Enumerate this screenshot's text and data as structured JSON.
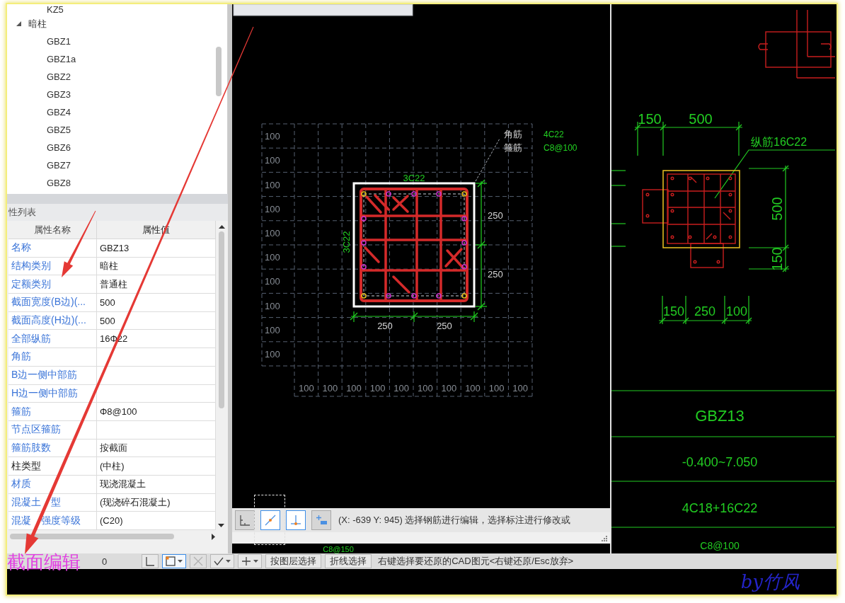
{
  "tree": {
    "items": [
      {
        "children": [
          {
            "label": "KZ5"
          }
        ]
      },
      {
        "label": "暗柱",
        "expanded": true,
        "children": [
          {
            "label": "GBZ1"
          },
          {
            "label": "GBZ1a"
          },
          {
            "label": "GBZ2"
          },
          {
            "label": "GBZ3"
          },
          {
            "label": "GBZ4"
          },
          {
            "label": "GBZ5"
          },
          {
            "label": "GBZ6"
          },
          {
            "label": "GBZ7"
          },
          {
            "label": "GBZ8"
          }
        ]
      }
    ]
  },
  "properties": {
    "title": "性列表",
    "columns": [
      "属性名称",
      "属性值"
    ],
    "rows": [
      {
        "name": "名称",
        "value": "GBZ13",
        "color": "#3a74d8"
      },
      {
        "name": "结构类别",
        "value": "暗柱",
        "color": "#3a74d8"
      },
      {
        "name": "定额类别",
        "value": "普通柱",
        "color": "#3a74d8"
      },
      {
        "name": "截面宽度(B边)(...",
        "value": "500",
        "color": "#3a74d8"
      },
      {
        "name": "截面高度(H边)(...",
        "value": "500",
        "color": "#3a74d8"
      },
      {
        "name": "全部纵筋",
        "value": "16Φ22",
        "color": "#3a74d8"
      },
      {
        "name": "角筋",
        "color": "#3a74d8"
      },
      {
        "name": "B边一侧中部筋",
        "color": "#3a74d8"
      },
      {
        "name": "H边一侧中部筋",
        "color": "#3a74d8"
      },
      {
        "name": "箍筋",
        "value": "Φ8@100",
        "color": "#3a74d8"
      },
      {
        "name": "节点区箍筋",
        "color": "#3a74d8"
      },
      {
        "name": "箍筋肢数",
        "value": "按截面",
        "color": "#3a74d8"
      },
      {
        "name": "柱类型",
        "value": "(中柱)",
        "color": "#222222"
      },
      {
        "name": "材质",
        "value": "现浇混凝土",
        "color": "#3a74d8"
      },
      {
        "name": "混凝土　型",
        "value": "(现浇碎石混凝土)",
        "color": "#3a74d8"
      },
      {
        "name": "混凝　强度等级",
        "value": "(C20)",
        "color": "#3a74d8"
      }
    ]
  },
  "section_editor": {
    "grid": {
      "row_labels": [
        "100",
        "100",
        "100",
        "100",
        "100",
        "100",
        "100",
        "100",
        "100",
        "100"
      ],
      "column_labels": [
        "100",
        "100",
        "100",
        "100",
        "100",
        "100",
        "100",
        "100",
        "100",
        "100"
      ]
    },
    "top_rebar": "3C22",
    "side_rebar": "3C22",
    "height_dims": [
      "250",
      "250"
    ],
    "width_dims": [
      "250",
      "250"
    ],
    "callouts": [
      {
        "label": "角筋",
        "spec": "4C22"
      },
      {
        "label": "箍筋",
        "spec": "C8@100"
      }
    ],
    "snap_buttons": [
      {
        "kind": "orthogonal",
        "on": false,
        "focused": false
      },
      {
        "kind": "endpoint",
        "on": true,
        "focused": true
      },
      {
        "kind": "perpendicular",
        "on": true,
        "focused": false
      },
      {
        "kind": "add-dimension",
        "on": false,
        "focused": false
      }
    ],
    "status": "(X: -639 Y: 945) 选择钢筋进行编辑，选择标注进行修改或"
  },
  "cad_drawing": {
    "top_dims": [
      "150",
      "500"
    ],
    "rebar_label": "纵筋16C22",
    "side_dims": [
      "500",
      "150"
    ],
    "bottom_dims": [
      "150",
      "250",
      "100"
    ],
    "table_cells": [
      "GBZ13",
      "-0.400~7.050",
      "4C18+16C22",
      "C8@100"
    ],
    "underlay_label": "C8@150"
  },
  "bottom_toolbar": {
    "count": "0",
    "tools": [
      {
        "kind": "dimension",
        "on": false,
        "disabled": false,
        "dropdown": false
      },
      {
        "kind": "snap-box",
        "on": true,
        "disabled": false,
        "dropdown": true
      },
      {
        "kind": "cross",
        "on": false,
        "disabled": true,
        "dropdown": false
      },
      {
        "kind": "angle",
        "on": false,
        "disabled": false,
        "dropdown": true
      },
      {
        "kind": "plus",
        "on": false,
        "disabled": false,
        "dropdown": true
      }
    ],
    "buttons": [
      "按图层选择",
      "折线选择"
    ],
    "hint": "右键选择要还原的CAD图元<右键还原/Esc放弃>"
  },
  "annotations": {
    "caption": "截面编辑",
    "signature": "by竹风"
  }
}
